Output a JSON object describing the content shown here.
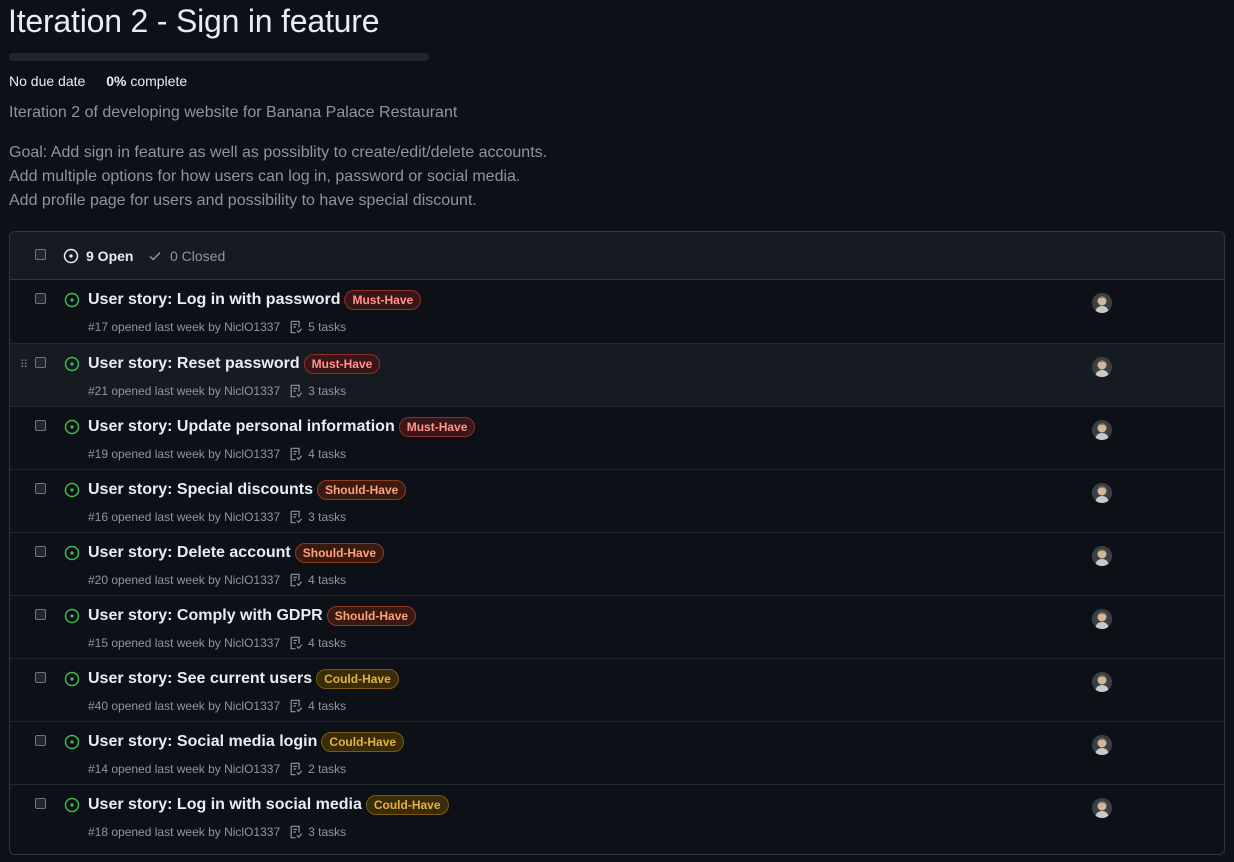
{
  "milestone": {
    "title": "Iteration 2 - Sign in feature",
    "due": "No due date",
    "percent": "0%",
    "complete_label": "complete",
    "progress_fraction": 0,
    "description": "Iteration 2 of developing website for Banana Palace Restaurant",
    "goal_lines": [
      "Goal: Add sign in feature as well as possiblity to create/edit/delete accounts.",
      "Add multiple options for how users can log in, password or social media.",
      "Add profile page for users and possibility to have special discount."
    ]
  },
  "filters": {
    "open_label": "9 Open",
    "closed_label": "0 Closed"
  },
  "label_colors": {
    "Must-Have": {
      "fg": "#ff9492",
      "bg": "#3a1616",
      "border": "#8e2e2e"
    },
    "Should-Have": {
      "fg": "#ffa178",
      "bg": "#3a1a10",
      "border": "#8e3b24"
    },
    "Could-Have": {
      "fg": "#e3b341",
      "bg": "#3a2c07",
      "border": "#7a5a0f"
    }
  },
  "issues": [
    {
      "title": "User story: Log in with password",
      "label": "Must-Have",
      "meta": "#17 opened last week by NiclO1337",
      "tasks": "5 tasks"
    },
    {
      "title": "User story: Reset password",
      "label": "Must-Have",
      "meta": "#21 opened last week by NiclO1337",
      "tasks": "3 tasks"
    },
    {
      "title": "User story: Update personal information",
      "label": "Must-Have",
      "meta": "#19 opened last week by NiclO1337",
      "tasks": "4 tasks"
    },
    {
      "title": "User story: Special discounts",
      "label": "Should-Have",
      "meta": "#16 opened last week by NiclO1337",
      "tasks": "3 tasks"
    },
    {
      "title": "User story: Delete account",
      "label": "Should-Have",
      "meta": "#20 opened last week by NiclO1337",
      "tasks": "4 tasks"
    },
    {
      "title": "User story: Comply with GDPR",
      "label": "Should-Have",
      "meta": "#15 opened last week by NiclO1337",
      "tasks": "4 tasks"
    },
    {
      "title": "User story: See current users",
      "label": "Could-Have",
      "meta": "#40 opened last week by NiclO1337",
      "tasks": "4 tasks"
    },
    {
      "title": "User story: Social media login",
      "label": "Could-Have",
      "meta": "#14 opened last week by NiclO1337",
      "tasks": "2 tasks"
    },
    {
      "title": "User story: Log in with social media",
      "label": "Could-Have",
      "meta": "#18 opened last week by NiclO1337",
      "tasks": "3 tasks"
    }
  ],
  "colors": {
    "open_icon": "#3fb950",
    "background": "#0d1117",
    "header_bg": "#161b22"
  }
}
